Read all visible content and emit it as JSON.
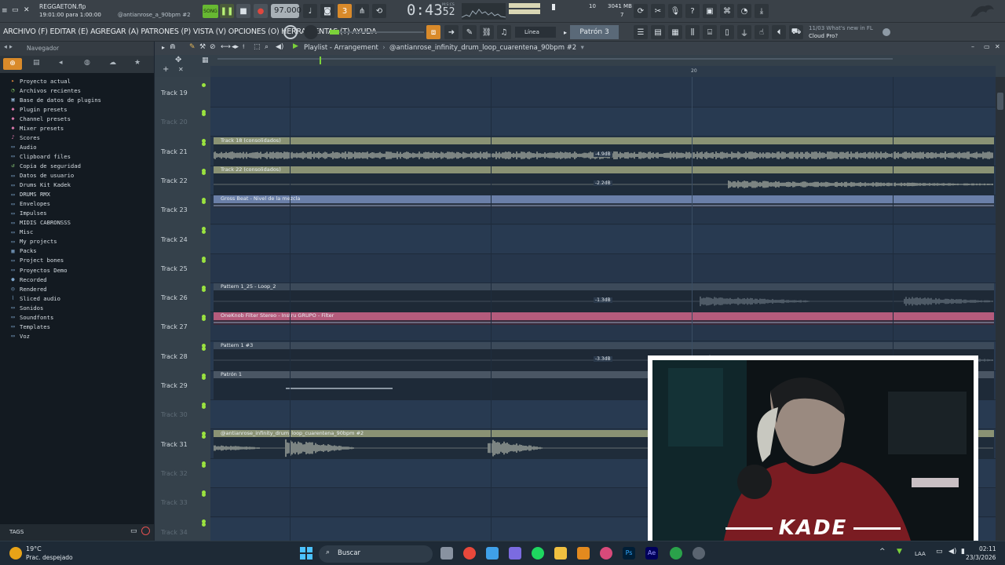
{
  "topbar": {
    "project_file": "REGGAETON.flp",
    "time_info": "19:01:00 para 1:00:00",
    "song_name": "@antianrose_a_90bpm #2",
    "song_label": "SONG",
    "tempo": "97.000",
    "clock": "0:43",
    "clock_sub": "52",
    "clock_unit": "M:S:CS",
    "memory": "3041 MB",
    "cpu": "10",
    "voices": "7",
    "pattern_digit": "3"
  },
  "menubar": {
    "menu_text": "ARCHIVO (F) EDITAR (E) AGREGAR (A) PATRONES (P) VISTA (V) OPCIONES (O) HERRAMIENTAS (T) AYUDA",
    "snap": "Línea",
    "pattern": "Patrón 3",
    "news_date": "11/03",
    "news_line1": "What's new in FL",
    "news_line2": "Cloud Pro?"
  },
  "browser": {
    "title": "Navegador",
    "tags_label": "TAGS",
    "items": [
      {
        "label": "Proyecto actual",
        "icon": "project-icon",
        "color": "#e58a3d"
      },
      {
        "label": "Archivos recientes",
        "icon": "recent-icon",
        "color": "#7fc25c"
      },
      {
        "label": "Base de datos de plugins",
        "icon": "plugin-db-icon",
        "color": "#8fb0d0"
      },
      {
        "label": "Plugin presets",
        "icon": "plugin-preset-icon",
        "color": "#e07ab0"
      },
      {
        "label": "Channel presets",
        "icon": "channel-preset-icon",
        "color": "#e07ab0"
      },
      {
        "label": "Mixer presets",
        "icon": "mixer-preset-icon",
        "color": "#e07ab0"
      },
      {
        "label": "Scores",
        "icon": "scores-icon",
        "color": "#e07ab0"
      },
      {
        "label": "Audio",
        "icon": "folder-icon",
        "color": "#7fa6cc"
      },
      {
        "label": "Clipboard files",
        "icon": "folder-icon",
        "color": "#7fa6cc"
      },
      {
        "label": "Copia de seguridad",
        "icon": "backup-icon",
        "color": "#8fd07a"
      },
      {
        "label": "Datos de usuario",
        "icon": "user-data-icon",
        "color": "#7fa6cc"
      },
      {
        "label": "Drums Kit Kadek",
        "icon": "folder-icon",
        "color": "#7fa6cc"
      },
      {
        "label": "DRUMS RMX",
        "icon": "folder-icon",
        "color": "#7fa6cc"
      },
      {
        "label": "Envelopes",
        "icon": "folder-icon",
        "color": "#7fa6cc"
      },
      {
        "label": "Impulses",
        "icon": "folder-icon",
        "color": "#7fa6cc"
      },
      {
        "label": "MIDIS CABRONSSS",
        "icon": "folder-icon",
        "color": "#7fa6cc"
      },
      {
        "label": "Misc",
        "icon": "folder-icon",
        "color": "#7fa6cc"
      },
      {
        "label": "My projects",
        "icon": "folder-icon",
        "color": "#7fa6cc"
      },
      {
        "label": "Packs",
        "icon": "packs-icon",
        "color": "#7fa6cc"
      },
      {
        "label": "Project bones",
        "icon": "folder-icon",
        "color": "#7fa6cc"
      },
      {
        "label": "Proyectos Demo",
        "icon": "folder-icon",
        "color": "#7fa6cc"
      },
      {
        "label": "Recorded",
        "icon": "recorded-icon",
        "color": "#7fa6cc"
      },
      {
        "label": "Rendered",
        "icon": "rendered-icon",
        "color": "#7fa6cc"
      },
      {
        "label": "Sliced audio",
        "icon": "sliced-icon",
        "color": "#7fa6cc"
      },
      {
        "label": "Sonidos",
        "icon": "folder-icon",
        "color": "#7fa6cc"
      },
      {
        "label": "Soundfonts",
        "icon": "folder-icon",
        "color": "#7fa6cc"
      },
      {
        "label": "Templates",
        "icon": "folder-icon",
        "color": "#7fa6cc"
      },
      {
        "label": "Voz",
        "icon": "folder-icon",
        "color": "#7fa6cc"
      }
    ]
  },
  "playlist": {
    "title": "Playlist - Arrangement",
    "arrangement": "@antianrose_infinity_drum_loop_cuarentena_90bpm #2",
    "ruler_mark": "20",
    "tracks": [
      {
        "name": "Track 19",
        "dim": false
      },
      {
        "name": "Track 20",
        "dim": true
      },
      {
        "name": "Track 21",
        "dim": false
      },
      {
        "name": "Track 22",
        "dim": false
      },
      {
        "name": "Track 23",
        "dim": false
      },
      {
        "name": "Track 24",
        "dim": false
      },
      {
        "name": "Track 25",
        "dim": false
      },
      {
        "name": "Track 26",
        "dim": false
      },
      {
        "name": "Track 27",
        "dim": false
      },
      {
        "name": "Track 28",
        "dim": false
      },
      {
        "name": "Track 29",
        "dim": false
      },
      {
        "name": "Track 30",
        "dim": true
      },
      {
        "name": "Track 31",
        "dim": false
      },
      {
        "name": "Track 32",
        "dim": true
      },
      {
        "name": "Track 33",
        "dim": true
      },
      {
        "name": "Track 34",
        "dim": true
      }
    ],
    "clips": [
      {
        "row": 2,
        "label": "Track 18 (consolidados)",
        "kind": "audio",
        "db": "-4.9dB",
        "color": "#8a9274"
      },
      {
        "row": 3,
        "label": "Track 22 (consolidados)",
        "kind": "audio",
        "db": "-2.2dB",
        "color": "#8a9274"
      },
      {
        "row": 4,
        "label": "Gross Beat - Nivel de la mezcla",
        "kind": "automation",
        "db": "",
        "color": "#6a7fa8"
      },
      {
        "row": 7,
        "label": "Pattern 1_25 - Loop_2",
        "kind": "audio-dark",
        "db": "-1.3dB",
        "color": "#3c4a5a"
      },
      {
        "row": 8,
        "label": "OneKnob Filter Stereo - Instru GRUPO - Filter",
        "kind": "automation",
        "db": "",
        "color": "#b45b7c"
      },
      {
        "row": 9,
        "label": "Pattern 1 #3",
        "kind": "audio-dark",
        "db": "-3.3dB",
        "color": "#3c4a5a"
      },
      {
        "row": 10,
        "label": "Patrón 1",
        "kind": "pattern",
        "db": "",
        "color": "#4a5664"
      },
      {
        "row": 12,
        "label": "@antianrose_infinity_drum_loop_cuarentena_90bpm #2",
        "kind": "audio",
        "db": "",
        "color": "#8a9274"
      }
    ]
  },
  "webcam": {
    "overlay_name": "KADE"
  },
  "taskbar": {
    "temperature": "19°C",
    "weather": "Prac. despejado",
    "search_placeholder": "Buscar",
    "time": "02:11",
    "date": "23/3/2026",
    "lang": "LAA"
  }
}
